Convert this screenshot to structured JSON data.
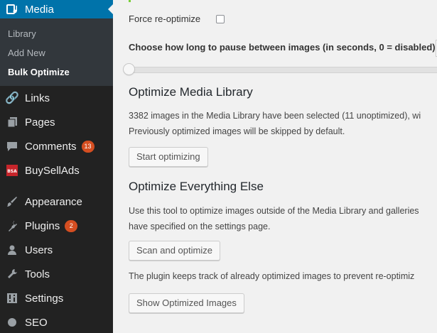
{
  "sidebar": {
    "media": {
      "label": "Media",
      "icon": "media-icon"
    },
    "submenu": [
      {
        "label": "Library"
      },
      {
        "label": "Add New"
      },
      {
        "label": "Bulk Optimize"
      }
    ],
    "items": [
      {
        "label": "Links",
        "icon": "links-icon"
      },
      {
        "label": "Pages",
        "icon": "pages-icon"
      },
      {
        "label": "Comments",
        "icon": "comments-icon",
        "badge": "13"
      },
      {
        "label": "BuySellAds",
        "icon": "buysellads-icon"
      },
      {
        "label": "Appearance",
        "icon": "appearance-icon"
      },
      {
        "label": "Plugins",
        "icon": "plugins-icon",
        "badge": "2"
      },
      {
        "label": "Users",
        "icon": "users-icon"
      },
      {
        "label": "Tools",
        "icon": "tools-icon"
      },
      {
        "label": "Settings",
        "icon": "settings-icon"
      },
      {
        "label": "SEO",
        "icon": "seo-icon"
      }
    ],
    "colors": {
      "background": "#222222",
      "active": "#0073aa",
      "submenu": "#32373c",
      "badge": "#d54e21"
    }
  },
  "main": {
    "force_reoptimize_label": "Force re-optimize",
    "pause_label": "Choose how long to pause between images (in seconds, 0 = disabled)",
    "media_library": {
      "heading": "Optimize Media Library",
      "line1": "3382 images in the Media Library have been selected (11 unoptimized), wi",
      "line2": "Previously optimized images will be skipped by default.",
      "button": "Start optimizing"
    },
    "everything_else": {
      "heading": "Optimize Everything Else",
      "line1": "Use this tool to optimize images outside of the Media Library and galleries",
      "line2": "have specified on the settings page.",
      "button": "Scan and optimize",
      "note": "The plugin keeps track of already optimized images to prevent re-optimiz",
      "button2": "Show Optimized Images"
    }
  }
}
